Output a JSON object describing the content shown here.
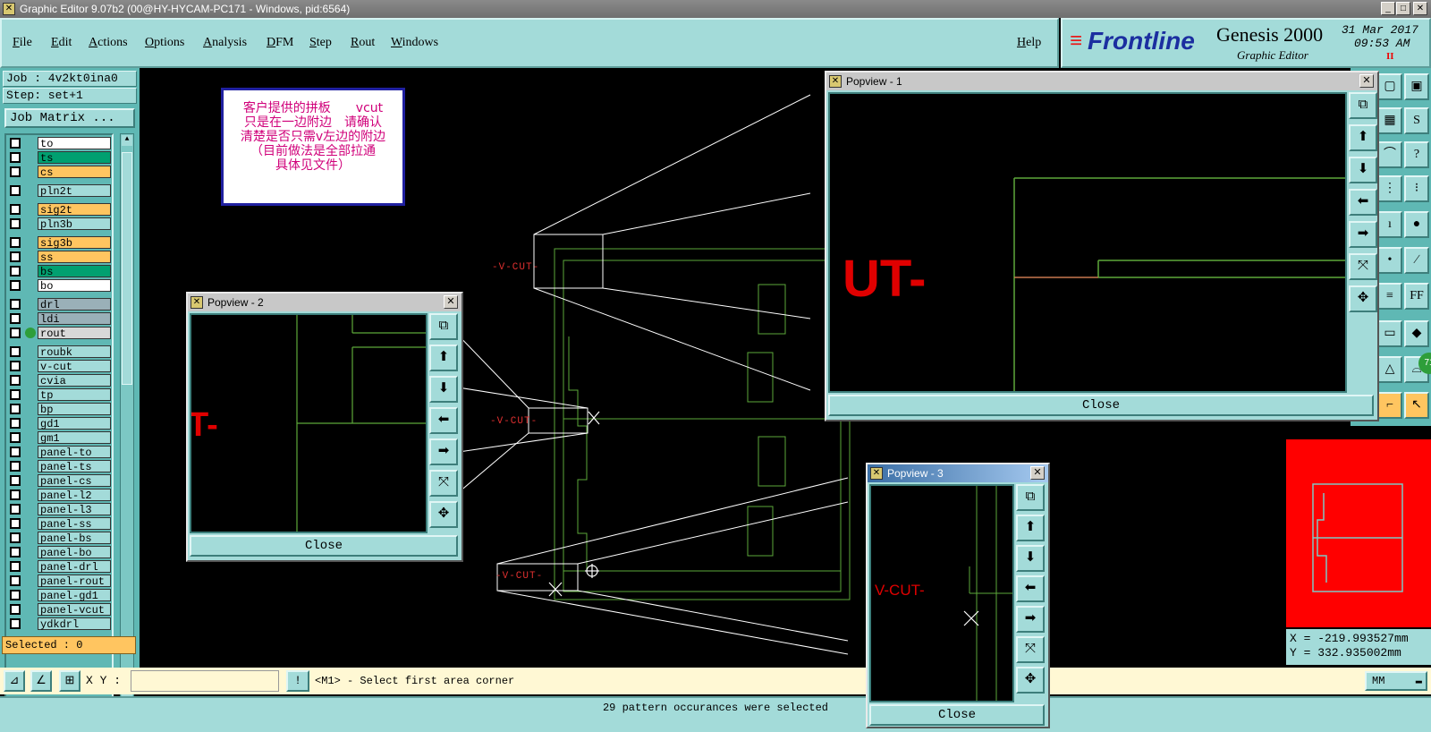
{
  "window": {
    "title": "Graphic Editor 9.07b2 (00@HY-HYCAM-PC171 - Windows, pid:6564)"
  },
  "menu": [
    "File",
    "Edit",
    "Actions",
    "Options",
    "Analysis",
    "DFM",
    "Step",
    "Rout",
    "Windows"
  ],
  "help_label": "Help",
  "brand": {
    "logo": "Frontline",
    "product": "Genesis 2000",
    "subtitle": "Graphic Editor",
    "date": "31 Mar 2017",
    "time": "09:53 AM",
    "indicator": "II"
  },
  "job": {
    "job_label": "Job : 4v2kt0ina0",
    "step_label": "Step: set+1",
    "matrix_button": "Job Matrix ..."
  },
  "layers": [
    {
      "name": "to",
      "color": "#ffffff"
    },
    {
      "name": "ts",
      "color": "#00a070"
    },
    {
      "name": "cs",
      "color": "#ffc560"
    },
    {
      "name": "pln2t",
      "color": "#a3dbd9"
    },
    {
      "name": "sig2t",
      "color": "#ffc560"
    },
    {
      "name": "pln3b",
      "color": "#a3dbd9"
    },
    {
      "name": "sig3b",
      "color": "#ffc560"
    },
    {
      "name": "ss",
      "color": "#ffc560"
    },
    {
      "name": "bs",
      "color": "#00a070"
    },
    {
      "name": "bo",
      "color": "#ffffff"
    },
    {
      "name": "drl",
      "color": "#9ab0b8"
    },
    {
      "name": "ldi",
      "color": "#9ab0b8"
    },
    {
      "name": "rout",
      "color": "#d8d8d8"
    },
    {
      "name": "roubk",
      "color": "#a3dbd9"
    },
    {
      "name": "v-cut",
      "color": "#a3dbd9"
    },
    {
      "name": "cvia",
      "color": "#a3dbd9"
    },
    {
      "name": "tp",
      "color": "#a3dbd9"
    },
    {
      "name": "bp",
      "color": "#a3dbd9"
    },
    {
      "name": "gd1",
      "color": "#a3dbd9"
    },
    {
      "name": "gm1",
      "color": "#a3dbd9"
    },
    {
      "name": "panel-to",
      "color": "#a3dbd9"
    },
    {
      "name": "panel-ts",
      "color": "#a3dbd9"
    },
    {
      "name": "panel-cs",
      "color": "#a3dbd9"
    },
    {
      "name": "panel-l2",
      "color": "#a3dbd9"
    },
    {
      "name": "panel-l3",
      "color": "#a3dbd9"
    },
    {
      "name": "panel-ss",
      "color": "#a3dbd9"
    },
    {
      "name": "panel-bs",
      "color": "#a3dbd9"
    },
    {
      "name": "panel-bo",
      "color": "#a3dbd9"
    },
    {
      "name": "panel-drl",
      "color": "#a3dbd9"
    },
    {
      "name": "panel-rout",
      "color": "#a3dbd9"
    },
    {
      "name": "panel-gd1",
      "color": "#a3dbd9"
    },
    {
      "name": "panel-vcut",
      "color": "#a3dbd9"
    },
    {
      "name": "ydkdrl",
      "color": "#a3dbd9"
    }
  ],
  "selected_label": "Selected : 0",
  "note": {
    "lines": [
      "客户提供的拼板　　vcut",
      "只是在一边附边　请确认",
      "清楚是否只需v左边的附边",
      "（目前做法是全部拉通",
      "具体见文件）"
    ]
  },
  "canvas": {
    "vcut_label": "-V-CUT-"
  },
  "popviews": [
    {
      "title": "Popview - 1",
      "text": "UT-",
      "close_label": "Close"
    },
    {
      "title": "Popview - 2",
      "text": "T-",
      "close_label": "Close"
    },
    {
      "title": "Popview - 3",
      "text": "V-CUT-",
      "close_label": "Close"
    }
  ],
  "coords": {
    "x": "X = -219.993527mm",
    "y": "Y = 332.935002mm"
  },
  "command": {
    "xy_label": "X Y :",
    "xy_value": "",
    "prompt": "<M1> - Select first area corner",
    "units": "MM"
  },
  "status": "29 pattern occurances were selected",
  "badge": "71"
}
